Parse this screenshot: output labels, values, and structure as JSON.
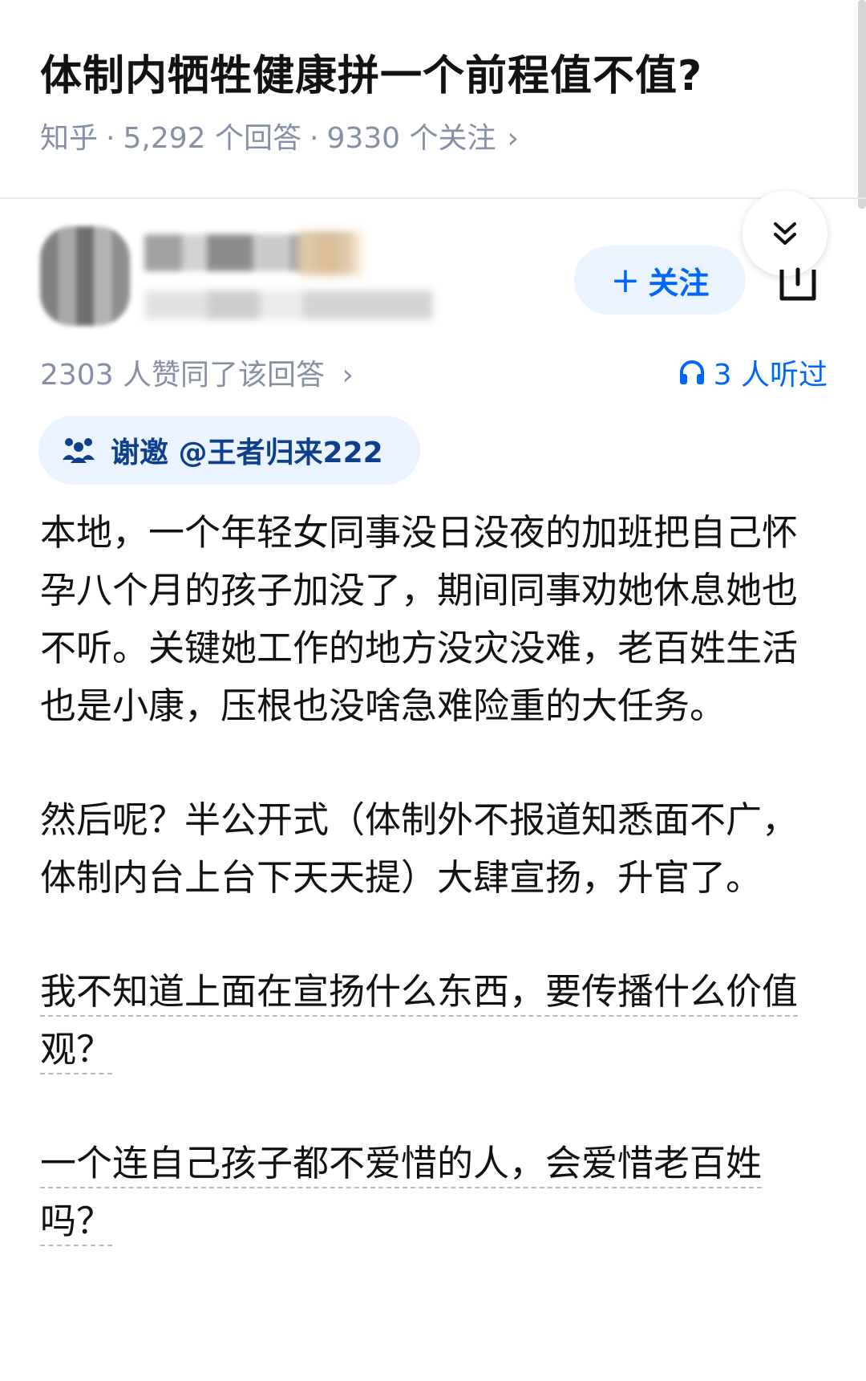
{
  "question": {
    "title": "体制内牺牲健康拼一个前程值不值?",
    "source": "知乎",
    "answers": "5,292 个回答",
    "followers": "9330 个关注",
    "chevron": "›"
  },
  "author": {
    "follow_label": "关注",
    "follow_plus": "+"
  },
  "stats": {
    "upvotes": "2303 人赞同了该回答",
    "upvotes_chevron": "›",
    "listened": "3 人听过"
  },
  "invite": {
    "label": "谢邀 @王者归来222"
  },
  "content": {
    "paragraphs": [
      "本地，一个年轻女同事没日没夜的加班把自己怀孕八个月的孩子加没了，期间同事劝她休息她也不听。关键她工作的地方没灾没难，老百姓生活也是小康，压根也没啥急难险重的大任务。",
      "然后呢？半公开式（体制外不报道知悉面不广，体制内台上台下天天提）大肆宣扬，升官了。",
      "我不知道上面在宣扬什么东西，要传播什么价值观？",
      "一个连自己孩子都不爱惜的人，会爱惜老百姓吗？"
    ]
  },
  "colors": {
    "accent": "#0066ff",
    "meta_gray": "#8590a6",
    "chip_bg": "#ebf3ff"
  },
  "icons": {
    "collapse": "double-chevron-down-icon",
    "share": "share-icon",
    "headphones": "headphones-icon",
    "invite": "invite-icon"
  }
}
